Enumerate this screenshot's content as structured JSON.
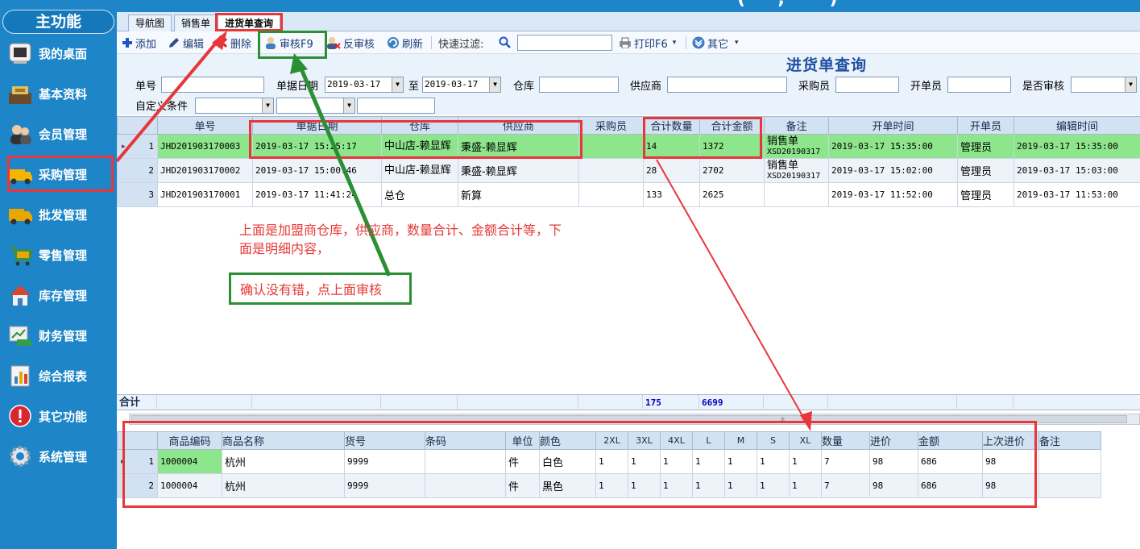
{
  "topbar": {
    "title_fragment": "(·· · , · · · )"
  },
  "sidebar": {
    "title": "主功能",
    "items": [
      {
        "label": "我的桌面",
        "icon": "desktop-icon"
      },
      {
        "label": "基本资料",
        "icon": "register-icon"
      },
      {
        "label": "会员管理",
        "icon": "members-icon"
      },
      {
        "label": "采购管理",
        "icon": "truck-icon",
        "active": true
      },
      {
        "label": "批发管理",
        "icon": "delivery-truck-icon"
      },
      {
        "label": "零售管理",
        "icon": "shopping-cart-icon"
      },
      {
        "label": "库存管理",
        "icon": "house-icon"
      },
      {
        "label": "财务管理",
        "icon": "finance-icon"
      },
      {
        "label": "综合报表",
        "icon": "bar-chart-icon"
      },
      {
        "label": "其它功能",
        "icon": "alert-icon"
      },
      {
        "label": "系统管理",
        "icon": "gear-icon"
      }
    ]
  },
  "tabs": [
    "导航图",
    "销售单",
    "进货单查询"
  ],
  "toolbar": {
    "add": "添加",
    "edit": "编辑",
    "delete": "删除",
    "audit": "审核F9",
    "unaudit": "反审核",
    "refresh": "刷新",
    "quick_filter": "快速过滤:",
    "print": "打印F6",
    "other": "其它"
  },
  "page_heading": "进货单查询",
  "filters": {
    "order_no_label": "单号",
    "date_label": "单据日期",
    "date_from": "2019-03-17",
    "to_label": "至",
    "date_to": "2019-03-17",
    "warehouse_label": "仓库",
    "supplier_label": "供应商",
    "buyer_label": "采购员",
    "creator_label": "开单员",
    "audited_label": "是否审核",
    "custom_label": "自定义条件"
  },
  "master": {
    "columns": [
      "单号",
      "单据日期",
      "仓库",
      "供应商",
      "采购员",
      "合计数量",
      "合计金额",
      "备注",
      "开单时间",
      "开单员",
      "编辑时间"
    ],
    "rows": [
      {
        "idx": "1",
        "no": "JHD201903170003",
        "date": "2019-03-17 15:25:17",
        "warehouse": "中山店-赖显辉",
        "supplier": "秉盛-赖显辉",
        "buyer": "",
        "qty": "14",
        "amount": "1372",
        "remark1": "销售单",
        "remark2": "XSD20190317",
        "created": "2019-03-17 15:35:00",
        "creator": "管理员",
        "edited": "2019-03-17 15:35:00"
      },
      {
        "idx": "2",
        "no": "JHD201903170002",
        "date": "2019-03-17 15:00:46",
        "warehouse": "中山店-赖显辉",
        "supplier": "秉盛-赖显辉",
        "buyer": "",
        "qty": "28",
        "amount": "2702",
        "remark1": "销售单",
        "remark2": "XSD20190317",
        "created": "2019-03-17 15:02:00",
        "creator": "管理员",
        "edited": "2019-03-17 15:03:00"
      },
      {
        "idx": "3",
        "no": "JHD201903170001",
        "date": "2019-03-17 11:41:24",
        "warehouse": "总仓",
        "supplier": "新算",
        "buyer": "",
        "qty": "133",
        "amount": "2625",
        "remark1": "",
        "remark2": "",
        "created": "2019-03-17 11:52:00",
        "creator": "管理员",
        "edited": "2019-03-17 11:53:00"
      }
    ],
    "sum_label": "合计",
    "sum_qty": "175",
    "sum_amount": "6699"
  },
  "detail": {
    "columns": [
      "商品编码",
      "商品名称",
      "货号",
      "条码",
      "单位",
      "颜色",
      "2XL",
      "3XL",
      "4XL",
      "L",
      "M",
      "S",
      "XL",
      "数量",
      "进价",
      "金额",
      "上次进价",
      "备注"
    ],
    "rows": [
      {
        "idx": "1",
        "code": "1000004",
        "name": "杭州",
        "sku": "9999",
        "barcode": "",
        "unit": "件",
        "color": "白色",
        "s2xl": "1",
        "s3xl": "1",
        "s4xl": "1",
        "l": "1",
        "m": "1",
        "s": "1",
        "xl": "1",
        "qty": "7",
        "price": "98",
        "amount": "686",
        "last_price": "98",
        "remark": ""
      },
      {
        "idx": "2",
        "code": "1000004",
        "name": "杭州",
        "sku": "9999",
        "barcode": "",
        "unit": "件",
        "color": "黑色",
        "s2xl": "1",
        "s3xl": "1",
        "s4xl": "1",
        "l": "1",
        "m": "1",
        "s": "1",
        "xl": "1",
        "qty": "7",
        "price": "98",
        "amount": "686",
        "last_price": "98",
        "remark": ""
      }
    ]
  },
  "annotation": {
    "note": "上面是加盟商仓库，供应商，数量合计、金额合计等，下面是明细内容，",
    "note2": "确认没有错，点上面审核"
  },
  "colors": {
    "sidebar": "#1e86c8",
    "selected_row": "#8de68b",
    "annotation_red": "#e8363a",
    "annotation_green": "#2b8f34"
  }
}
